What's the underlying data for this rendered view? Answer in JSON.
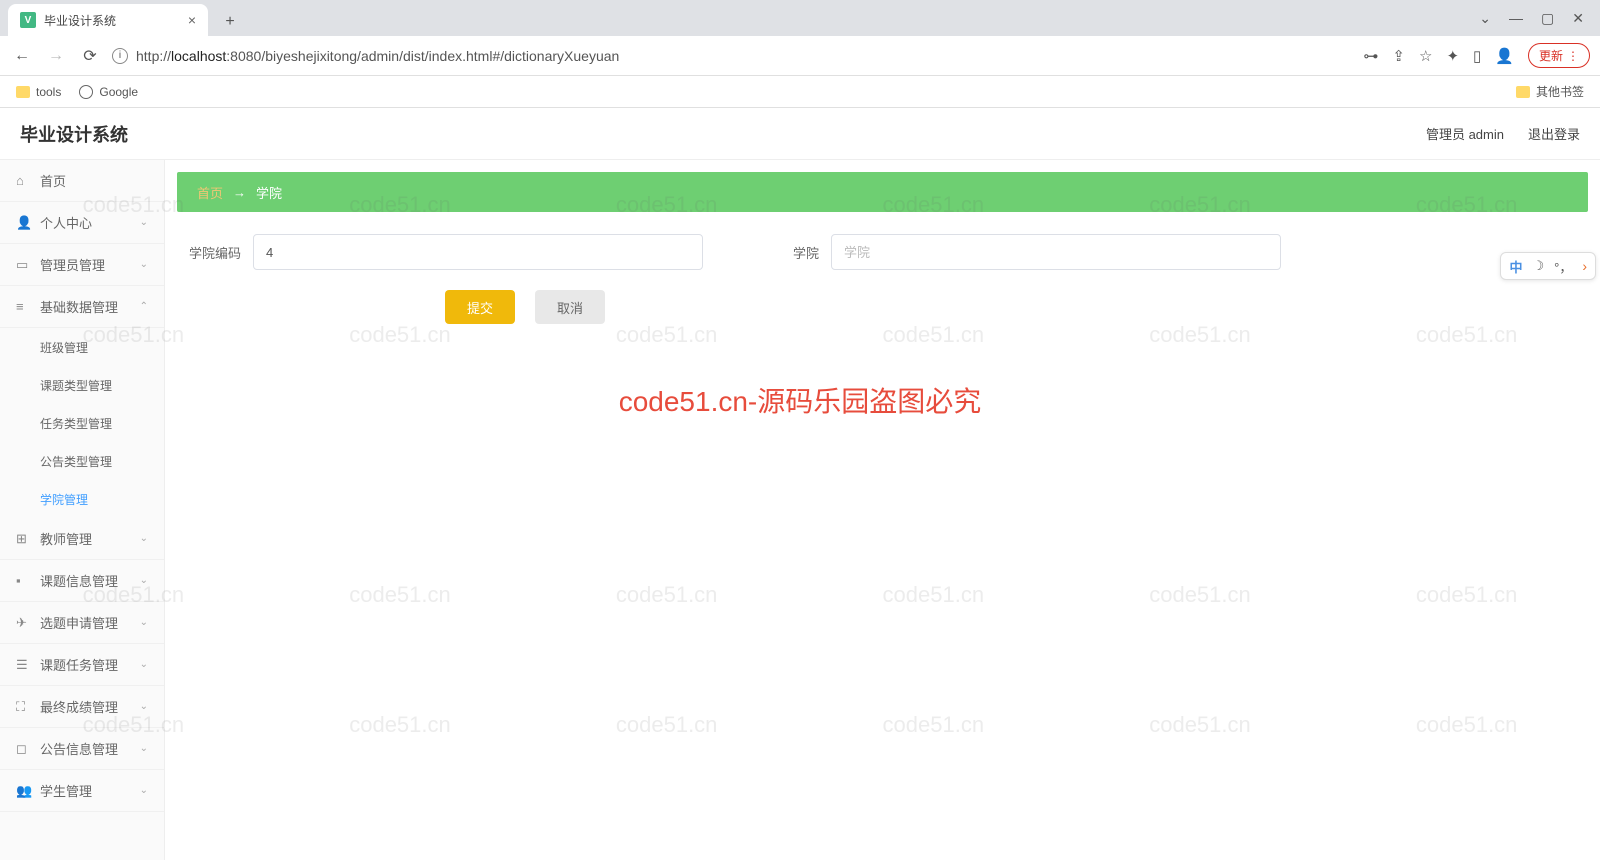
{
  "browser": {
    "tab_title": "毕业设计系统",
    "url_prefix": "http://",
    "url_host": "localhost",
    "url_rest": ":8080/biyeshejixitong/admin/dist/index.html#/dictionaryXueyuan",
    "update_label": "更新",
    "bookmarks": {
      "tools": "tools",
      "google": "Google",
      "other": "其他书签"
    }
  },
  "header": {
    "title": "毕业设计系统",
    "admin_label": "管理员 admin",
    "logout": "退出登录"
  },
  "sidebar": {
    "home": "首页",
    "personal": "个人中心",
    "admin_mgmt": "管理员管理",
    "base_data": "基础数据管理",
    "subs": {
      "class": "班级管理",
      "topic_type": "课题类型管理",
      "task_type": "任务类型管理",
      "notice_type": "公告类型管理",
      "college": "学院管理"
    },
    "teacher": "教师管理",
    "topic_info": "课题信息管理",
    "select_apply": "选题申请管理",
    "topic_task": "课题任务管理",
    "final_grade": "最终成绩管理",
    "notice_info": "公告信息管理",
    "student": "学生管理"
  },
  "breadcrumb": {
    "home": "首页",
    "sep": "→",
    "current": "学院"
  },
  "form": {
    "code_label": "学院编码",
    "code_value": "4",
    "name_label": "学院",
    "name_placeholder": "学院",
    "submit": "提交",
    "cancel": "取消"
  },
  "watermark": {
    "main": "code51.cn-源码乐园盗图必究",
    "tile": "code51.cn"
  },
  "ime": {
    "zh": "中",
    "moon": "☽",
    "comma": "°，",
    "arrow": "›"
  }
}
